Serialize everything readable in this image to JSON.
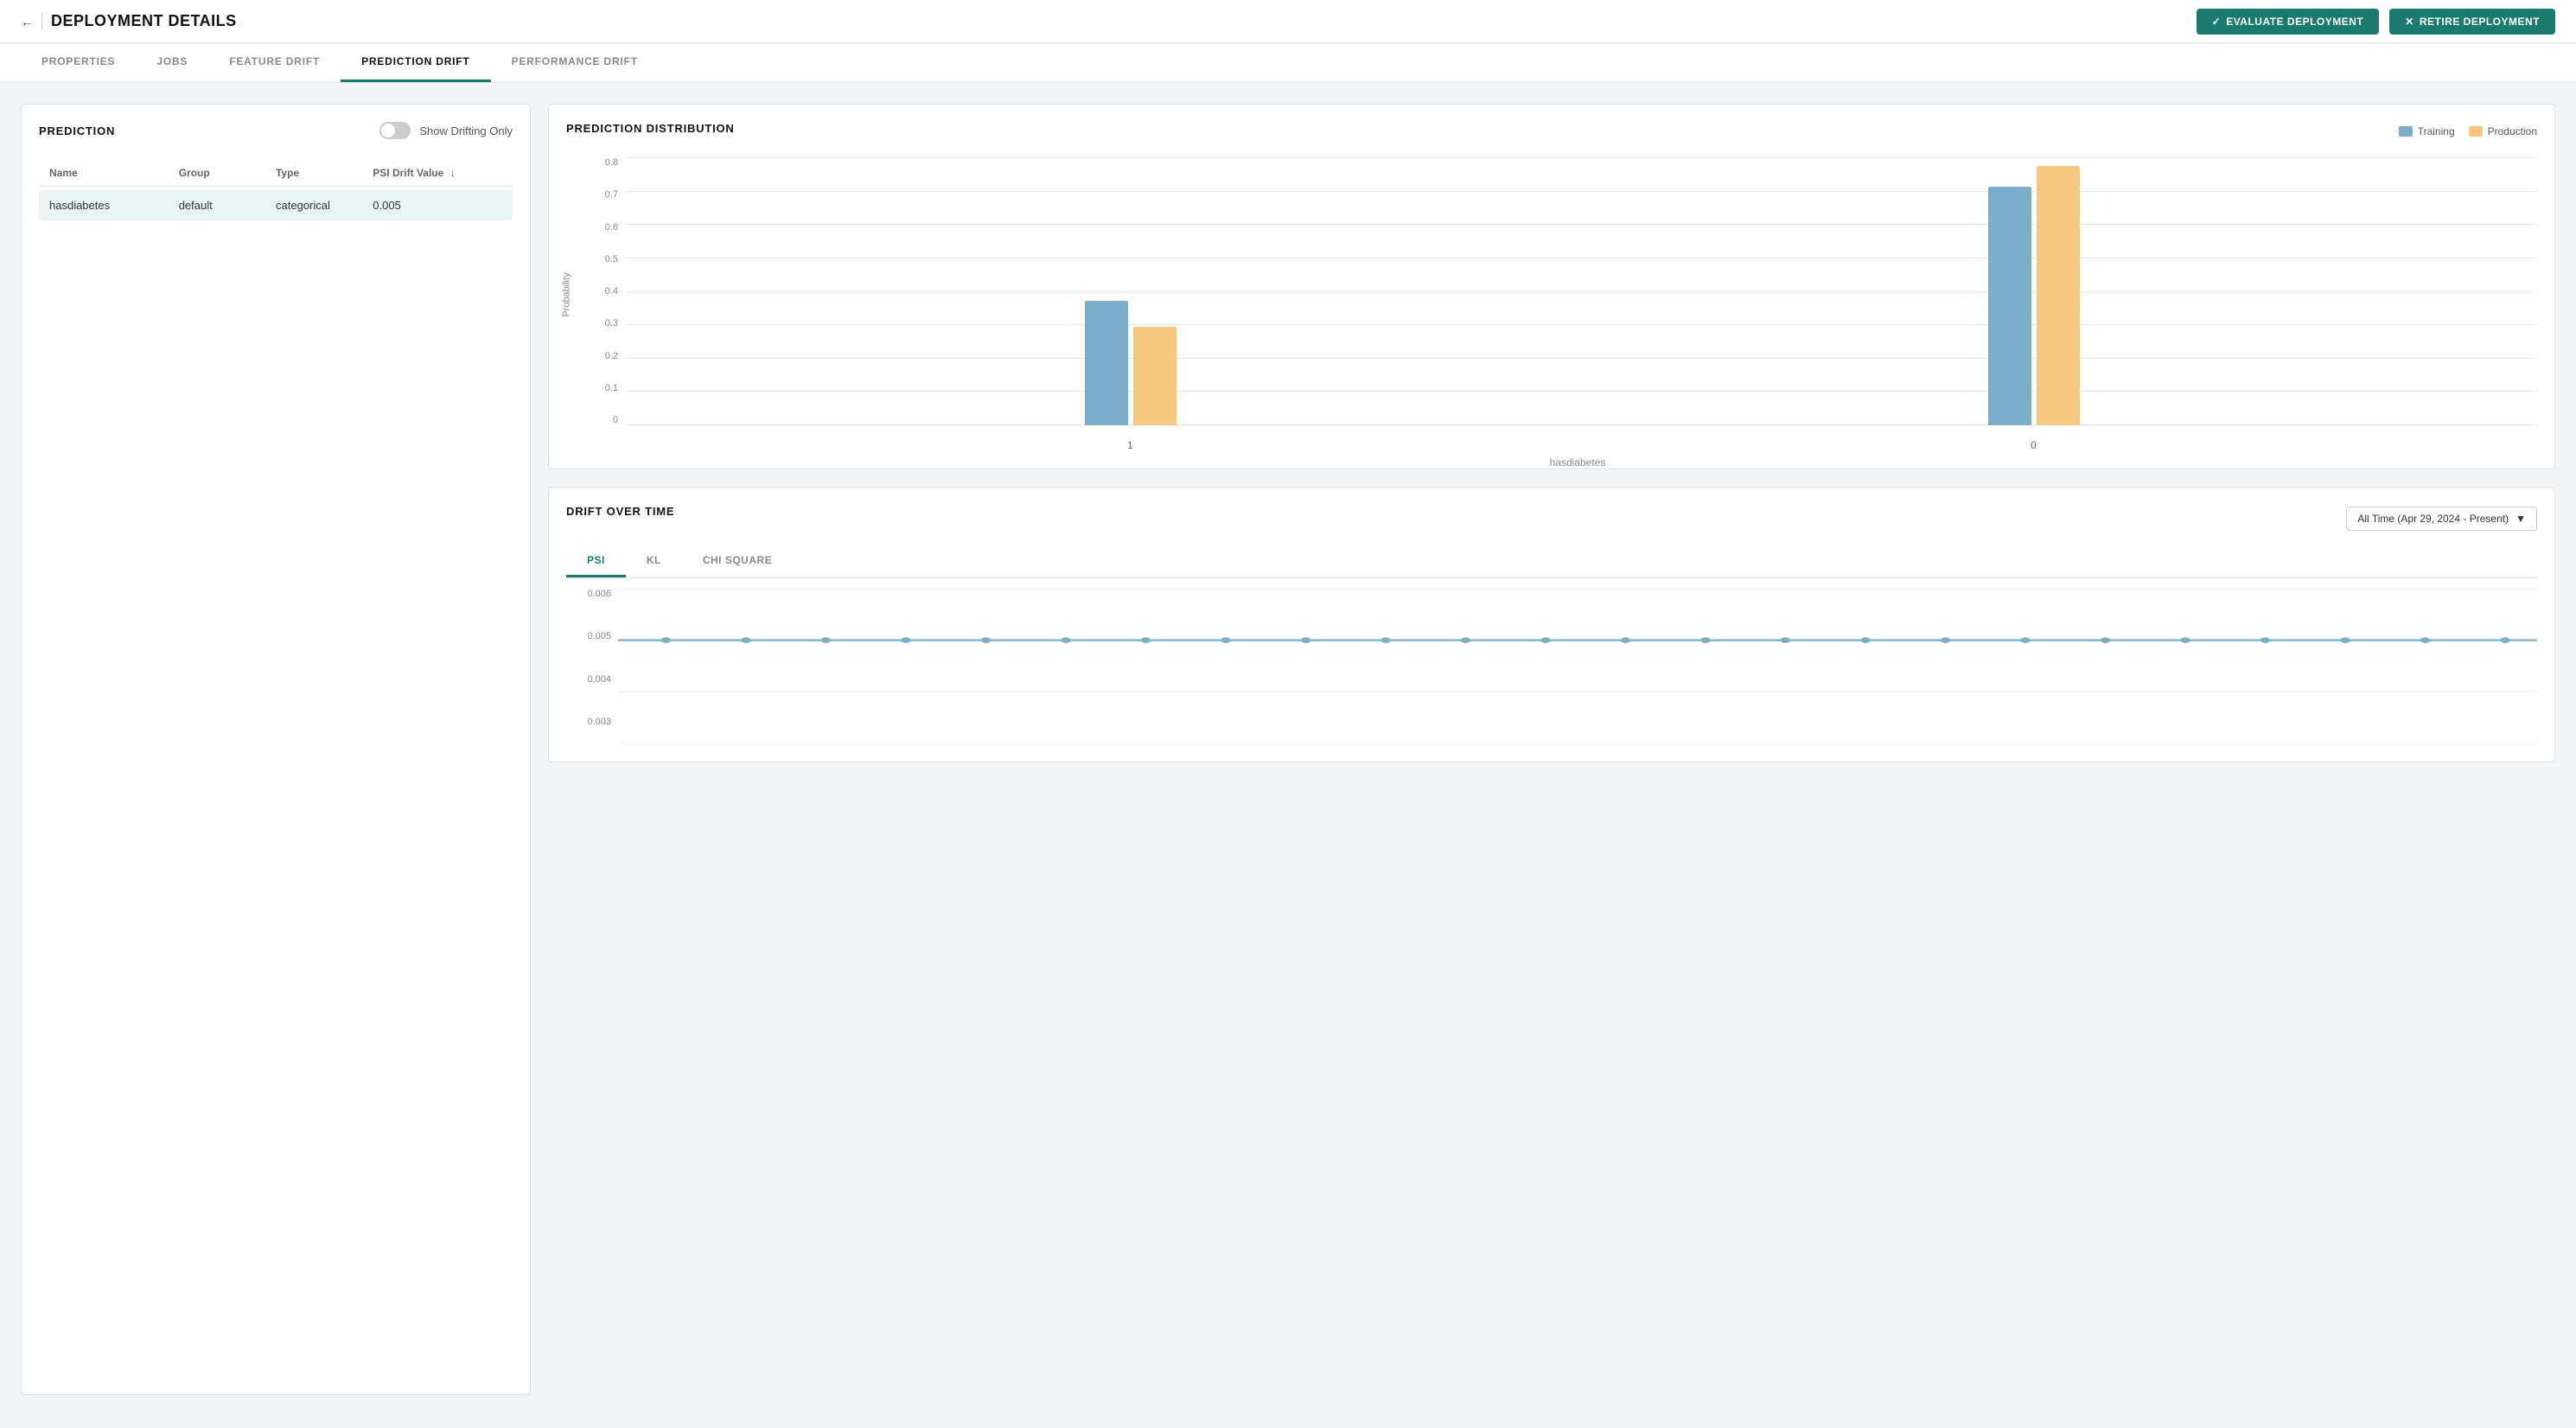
{
  "header": {
    "title": "DEPLOYMENT DETAILS",
    "back_label": "←",
    "evaluate_btn": "EVALUATE DEPLOYMENT",
    "retire_btn": "RETIRE DEPLOYMENT"
  },
  "tabs": [
    {
      "id": "properties",
      "label": "PROPERTIES",
      "active": false
    },
    {
      "id": "jobs",
      "label": "JOBS",
      "active": false
    },
    {
      "id": "feature-drift",
      "label": "FEATURE DRIFT",
      "active": false
    },
    {
      "id": "prediction-drift",
      "label": "PREDICTION DRIFT",
      "active": true
    },
    {
      "id": "performance-drift",
      "label": "PERFORMANCE DRIFT",
      "active": false
    }
  ],
  "prediction_panel": {
    "title": "PREDICTION",
    "toggle_label": "Show Drifting Only",
    "table": {
      "columns": [
        "Name",
        "Group",
        "Type",
        "PSI Drift Value"
      ],
      "rows": [
        {
          "name": "hasdiabetes",
          "group": "default",
          "type": "categorical",
          "psi": "0.005"
        }
      ]
    }
  },
  "distribution_chart": {
    "title": "PREDICTION DISTRIBUTION",
    "legend": {
      "training_label": "Training",
      "production_label": "Production",
      "training_color": "#7bafc9",
      "production_color": "#f5c882"
    },
    "y_labels": [
      "0.8",
      "0.7",
      "0.6",
      "0.5",
      "0.4",
      "0.3",
      "0.2",
      "0.1",
      "0"
    ],
    "y_axis_title": "Probability",
    "x_axis_title": "hasdiabetes",
    "bars": [
      {
        "x_label": "1",
        "training_height": 44,
        "production_height": 36,
        "training_pct": 0.34,
        "production_pct": 0.27
      },
      {
        "x_label": "0",
        "training_height": 83,
        "production_height": 90,
        "training_pct": 0.66,
        "production_pct": 0.73
      }
    ]
  },
  "drift_over_time": {
    "title": "DRIFT OVER TIME",
    "time_filter": "All Time (Apr 29, 2024 - Present)",
    "tabs": [
      "PSI",
      "KL",
      "CHI SQUARE"
    ],
    "active_tab": "PSI",
    "y_labels": [
      "0.006",
      "0.005",
      "0.004",
      "0.003"
    ],
    "line_value": 0.005
  }
}
